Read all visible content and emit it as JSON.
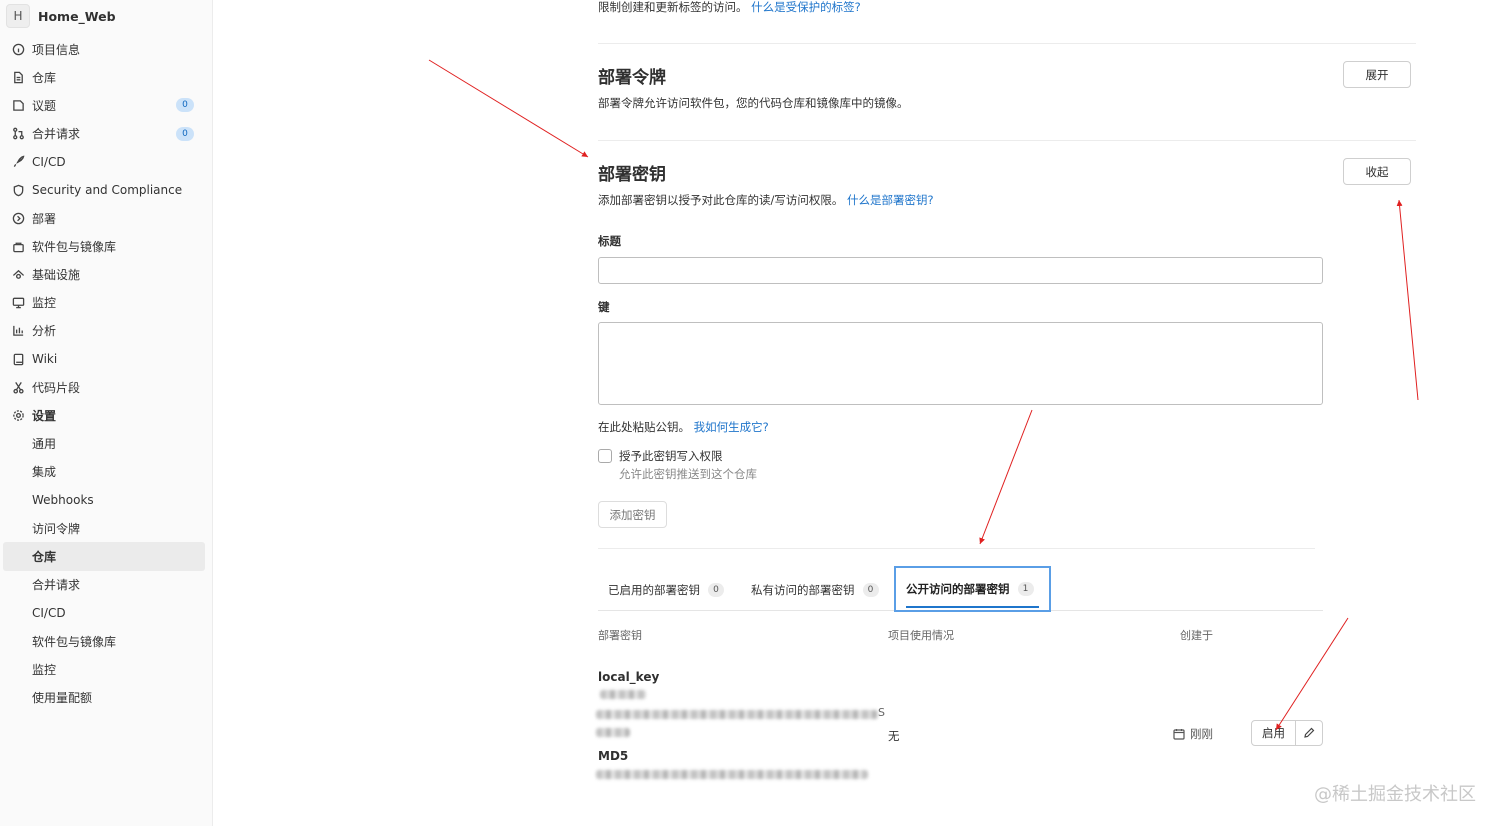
{
  "project": {
    "avatar_letter": "H",
    "name": "Home_Web"
  },
  "sidebar": {
    "items": [
      {
        "label": "项目信息",
        "icon": "info-icon"
      },
      {
        "label": "仓库",
        "icon": "document-icon"
      },
      {
        "label": "议题",
        "icon": "issues-icon",
        "badge": "0"
      },
      {
        "label": "合并请求",
        "icon": "merge-request-icon",
        "badge": "0"
      },
      {
        "label": "CI/CD",
        "icon": "rocket-icon"
      },
      {
        "label": "Security and Compliance",
        "icon": "shield-icon"
      },
      {
        "label": "部署",
        "icon": "deployments-icon"
      },
      {
        "label": "软件包与镜像库",
        "icon": "package-icon"
      },
      {
        "label": "基础设施",
        "icon": "cloud-icon"
      },
      {
        "label": "监控",
        "icon": "monitor-icon"
      },
      {
        "label": "分析",
        "icon": "chart-icon"
      },
      {
        "label": "Wiki",
        "icon": "book-icon"
      },
      {
        "label": "代码片段",
        "icon": "scissors-icon"
      },
      {
        "label": "设置",
        "icon": "gear-icon"
      }
    ],
    "settings_sub": [
      "通用",
      "集成",
      "Webhooks",
      "访问令牌",
      "仓库",
      "合并请求",
      "CI/CD",
      "软件包与镜像库",
      "监控",
      "使用量配额"
    ],
    "active_sub": "仓库"
  },
  "protected_tags": {
    "desc": "限制创建和更新标签的访问。",
    "link": "什么是受保护的标签?"
  },
  "deploy_tokens": {
    "title": "部署令牌",
    "desc": "部署令牌允许访问软件包，您的代码仓库和镜像库中的镜像。",
    "button": "展开"
  },
  "deploy_keys": {
    "title": "部署密钥",
    "desc": "添加部署密钥以授予对此仓库的读/写访问权限。",
    "link": "什么是部署密钥?",
    "button": "收起",
    "title_label": "标题",
    "key_label": "键",
    "paste_help": "在此处粘贴公钥。",
    "paste_link": "我如何生成它?",
    "write_access_label": "授予此密钥写入权限",
    "write_access_help": "允许此密钥推送到这个仓库",
    "add_button": "添加密钥",
    "tabs": [
      {
        "label": "已启用的部署密钥",
        "count": "0"
      },
      {
        "label": "私有访问的部署密钥",
        "count": "0"
      },
      {
        "label": "公开访问的部署密钥",
        "count": "1"
      }
    ],
    "columns": [
      "部署密钥",
      "项目使用情况",
      "创建于"
    ],
    "row": {
      "name": "local_key",
      "hash_fragment": "S",
      "md5_label": "MD5",
      "usage": "无",
      "created": "刚刚",
      "enable_button": "启用"
    }
  },
  "watermark": "@稀土掘金技术社区",
  "colors": {
    "link": "#1f75cb",
    "arrow": "#e02020",
    "active_tab_border": "#5a9ee6"
  }
}
